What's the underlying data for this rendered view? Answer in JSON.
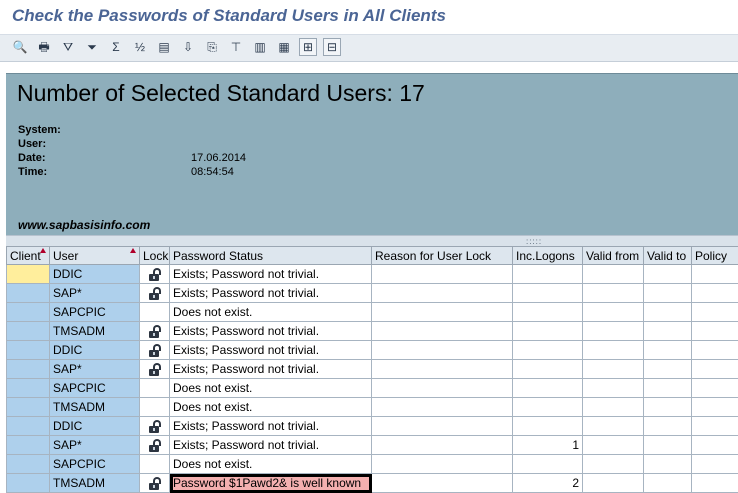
{
  "window": {
    "title": "Check the Passwords of Standard Users in All Clients"
  },
  "toolbar": {
    "buttons": [
      {
        "icon": "details-icon",
        "glyph": "🔍"
      },
      {
        "icon": "print-icon",
        "glyph": "🖶"
      },
      {
        "icon": "filter-icon",
        "glyph": "⛛"
      },
      {
        "icon": "set-filter-icon",
        "glyph": "⏷"
      },
      {
        "icon": "sum-icon",
        "glyph": "Σ"
      },
      {
        "icon": "subtotal-icon",
        "glyph": "½"
      },
      {
        "icon": "spreadsheet-icon",
        "glyph": "▤"
      },
      {
        "icon": "export-icon",
        "glyph": "⇩"
      },
      {
        "icon": "local-file-icon",
        "glyph": "⎘"
      },
      {
        "icon": "abc-analysis-icon",
        "glyph": "⊤"
      },
      {
        "icon": "graphic-icon",
        "glyph": "▥"
      },
      {
        "icon": "layout-icon",
        "glyph": "▦"
      },
      {
        "icon": "select-layout-icon",
        "glyph": "⊞"
      },
      {
        "icon": "save-layout-icon",
        "glyph": "⊟"
      }
    ]
  },
  "header": {
    "title": "Number of Selected Standard Users: 17",
    "fields": [
      {
        "label": "System:",
        "value": ""
      },
      {
        "label": "User:",
        "value": ""
      },
      {
        "label": "Date:",
        "value": "17.06.2014"
      },
      {
        "label": "Time:",
        "value": "08:54:54"
      }
    ],
    "website": "www.sapbasisinfo.com"
  },
  "table": {
    "columns": [
      "Client",
      "User",
      "Lock",
      "Password Status",
      "Reason for User Lock",
      "Inc.Logons",
      "Valid from",
      "Valid to",
      "Policy"
    ],
    "rows": [
      {
        "client": "",
        "user": "DDIC",
        "lock": true,
        "status": "Exists; Password not trivial.",
        "reason": "",
        "logons": "",
        "valid_from": "",
        "valid_to": "",
        "policy": "",
        "warn": false
      },
      {
        "client": "",
        "user": "SAP*",
        "lock": true,
        "status": "Exists; Password not trivial.",
        "reason": "",
        "logons": "",
        "valid_from": "",
        "valid_to": "",
        "policy": "",
        "warn": false
      },
      {
        "client": "",
        "user": "SAPCPIC",
        "lock": false,
        "status": "Does not exist.",
        "reason": "",
        "logons": "",
        "valid_from": "",
        "valid_to": "",
        "policy": "",
        "warn": false
      },
      {
        "client": "",
        "user": "TMSADM",
        "lock": true,
        "status": "Exists; Password not trivial.",
        "reason": "",
        "logons": "",
        "valid_from": "",
        "valid_to": "",
        "policy": "",
        "warn": false
      },
      {
        "client": "",
        "user": "DDIC",
        "lock": true,
        "status": "Exists; Password not trivial.",
        "reason": "",
        "logons": "",
        "valid_from": "",
        "valid_to": "",
        "policy": "",
        "warn": false
      },
      {
        "client": "",
        "user": "SAP*",
        "lock": true,
        "status": "Exists; Password not trivial.",
        "reason": "",
        "logons": "",
        "valid_from": "",
        "valid_to": "",
        "policy": "",
        "warn": false
      },
      {
        "client": "",
        "user": "SAPCPIC",
        "lock": false,
        "status": "Does not exist.",
        "reason": "",
        "logons": "",
        "valid_from": "",
        "valid_to": "",
        "policy": "",
        "warn": false
      },
      {
        "client": "",
        "user": "TMSADM",
        "lock": false,
        "status": "Does not exist.",
        "reason": "",
        "logons": "",
        "valid_from": "",
        "valid_to": "",
        "policy": "",
        "warn": false
      },
      {
        "client": "",
        "user": "DDIC",
        "lock": true,
        "status": "Exists; Password not trivial.",
        "reason": "",
        "logons": "",
        "valid_from": "",
        "valid_to": "",
        "policy": "",
        "warn": false
      },
      {
        "client": "",
        "user": "SAP*",
        "lock": true,
        "status": "Exists; Password not trivial.",
        "reason": "",
        "logons": "1",
        "valid_from": "",
        "valid_to": "",
        "policy": "",
        "warn": false
      },
      {
        "client": "",
        "user": "SAPCPIC",
        "lock": false,
        "status": "Does not exist.",
        "reason": "",
        "logons": "",
        "valid_from": "",
        "valid_to": "",
        "policy": "",
        "warn": false
      },
      {
        "client": "",
        "user": "TMSADM",
        "lock": true,
        "status": "Password $1Pawd2& is well known",
        "reason": "",
        "logons": "2",
        "valid_from": "",
        "valid_to": "",
        "policy": "",
        "warn": true
      }
    ]
  },
  "colors": {
    "header_panel": "#8eaebb",
    "user_cell": "#aed0ec",
    "client_cell": "#ffee9c",
    "warning_cell": "#f4b0b0",
    "title_text": "#4b6595"
  }
}
